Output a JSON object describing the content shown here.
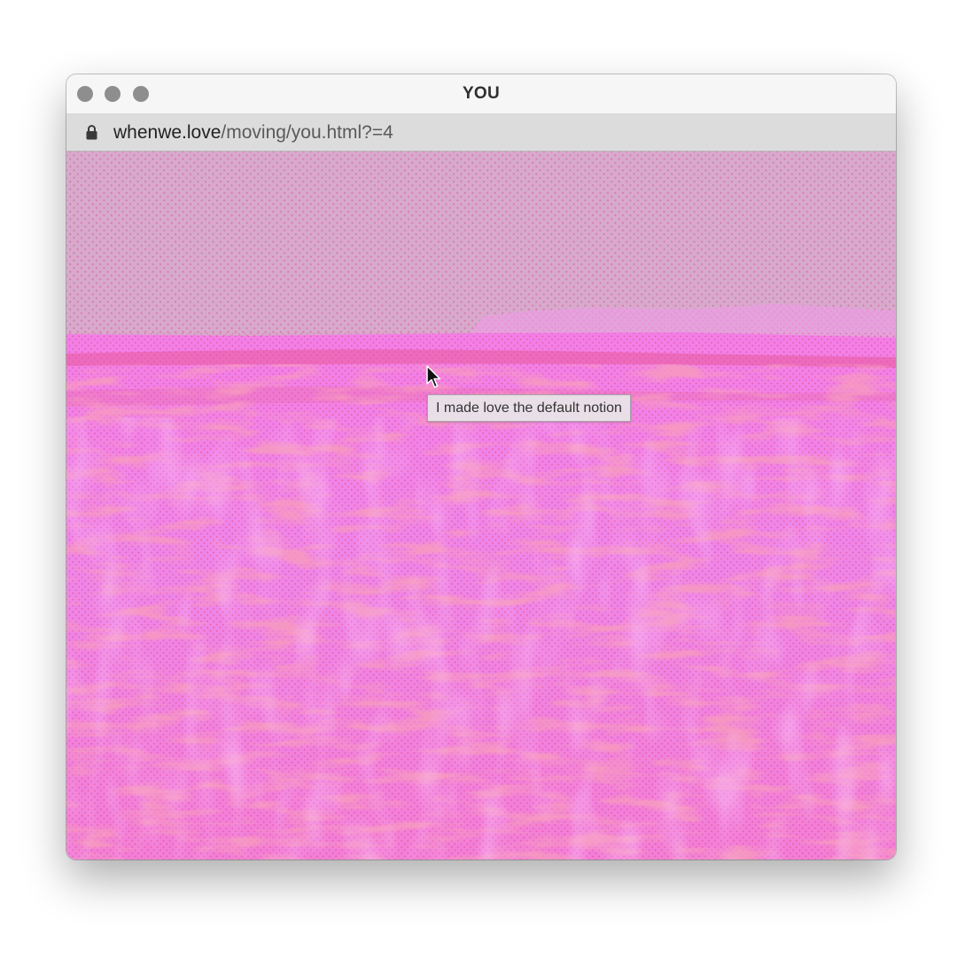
{
  "window": {
    "title": "YOU",
    "controls": [
      "close-button",
      "minimize-button",
      "zoom-button"
    ]
  },
  "address_bar": {
    "domain": "whenwe.love",
    "path": "/moving/you.html?=4",
    "secure": true
  },
  "content": {
    "image": "halftone-pink-wheat-field",
    "tooltip": "I made love the default notion"
  },
  "colors": {
    "sky": "#d8a9cf",
    "field": "#f47ae6",
    "field_dark": "#ef5d8e",
    "traffic_light": "#8e8e8e"
  }
}
